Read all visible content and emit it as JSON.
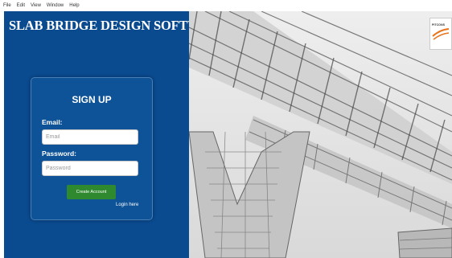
{
  "menubar": {
    "items": [
      "File",
      "Edit",
      "View",
      "Window",
      "Help"
    ]
  },
  "app": {
    "title": "SLAB BRIDGE DESIGN SOFTWARE"
  },
  "signup": {
    "title": "SIGN UP",
    "email_label": "Email:",
    "email_placeholder": "Email",
    "password_label": "Password:",
    "password_placeholder": "Password",
    "create_button": "Create Account",
    "login_link": "Login here"
  },
  "logo": {
    "text": "PITCONS"
  },
  "colors": {
    "panel": "#0a4a8f",
    "button": "#2f8a2f",
    "logo_accent": "#e8731a"
  }
}
